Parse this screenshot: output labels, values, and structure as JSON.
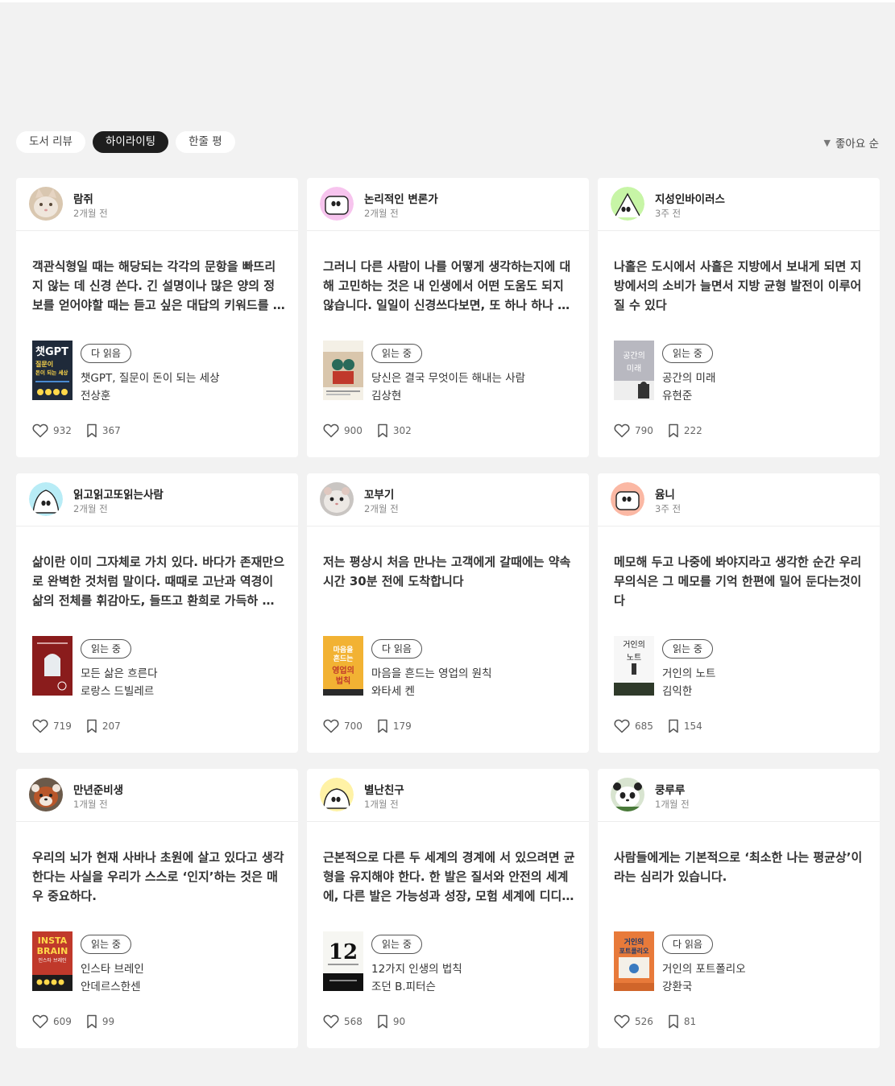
{
  "tabs": [
    {
      "label": "도서 리뷰",
      "active": false
    },
    {
      "label": "하이라이팅",
      "active": true
    },
    {
      "label": "한줄 평",
      "active": false
    }
  ],
  "sort": {
    "label": "좋아요 순",
    "icon": "caret-down-icon"
  },
  "cards": [
    {
      "user": "람쥐",
      "time": "2개월 전",
      "avatar": "cat-photo",
      "quote": "객관식형일 때는 해당되는 각각의 문항을 빠뜨리지 않는 데 신경 쓴다. 긴 설명이나 많은 양의 정보를 얻어야할 때는 듣고 싶은 대답의 키워드를 넣어서 질문한다.",
      "status": "다 읽음",
      "book_title": "챗GPT, 질문이 돈이 되는 세상",
      "book_author": "전상훈",
      "cover_text": [
        "챗GPT",
        "질문이",
        "돈이 되는 세상"
      ],
      "likes": "932",
      "bookmarks": "367"
    },
    {
      "user": "논리적인 변론가",
      "time": "2개월 전",
      "avatar": "pink-face",
      "quote": "그러니 다른 사람이 나를 어떻게 생각하는지에 대해 고민하는 것은 내 인생에서 어떤 도움도 되지 않습니다. 일일이 신경쓰다보면, 또 하나 하나 신경쓰다 보면",
      "status": "읽는 중",
      "book_title": "당신은 결국 무엇이든 해내는 사람",
      "book_author": "김상현",
      "cover_text": [],
      "likes": "900",
      "bookmarks": "302"
    },
    {
      "user": "지성인바이러스",
      "time": "3주 전",
      "avatar": "green-face",
      "quote": "나홀은 도시에서 사흘은 지방에서 보내게 되면 지방에서의 소비가 늘면서 지방 균형 발전이 이루어질 수 있다",
      "status": "읽는 중",
      "book_title": "공간의 미래",
      "book_author": "유현준",
      "cover_text": [
        "공간의",
        "미래"
      ],
      "likes": "790",
      "bookmarks": "222"
    },
    {
      "user": "읽고읽고또읽는사람",
      "time": "2개월 전",
      "avatar": "blue-face",
      "quote": "삶이란 이미 그자체로 가치 있다. 바다가 존재만으로 완벽한 것처럼 말이다. 때때로 고난과 역경이 삶의 전체를 휘감아도, 들뜨고 환희로 가득하 순간이 와도",
      "status": "읽는 중",
      "book_title": "모든 삶은 흐른다",
      "book_author": "로랑스 드빌레르",
      "cover_text": [],
      "likes": "719",
      "bookmarks": "207"
    },
    {
      "user": "꼬부기",
      "time": "2개월 전",
      "avatar": "hamster-photo",
      "quote": "저는 평상시 처음 만나는 고객에게 갈때에는  약속 시간 30분 전에 도착합니다",
      "status": "다 읽음",
      "book_title": "마음을 흔드는 영업의 원칙",
      "book_author": "와타세 켄",
      "cover_text": [
        "마음을",
        "흔드는",
        "영업의",
        "법칙"
      ],
      "likes": "700",
      "bookmarks": "179"
    },
    {
      "user": "윰니",
      "time": "3주 전",
      "avatar": "salmon-face",
      "quote": "메모해 두고 나중에 봐야지라고 생각한 순간 우리 무의식은 그 메모를 기억 한편에 밀어 둔다는것이다",
      "status": "읽는 중",
      "book_title": "거인의 노트",
      "book_author": "김익한",
      "cover_text": [
        "거인의",
        "노트"
      ],
      "likes": "685",
      "bookmarks": "154"
    },
    {
      "user": "만년준비생",
      "time": "1개월 전",
      "avatar": "redpanda-photo",
      "quote": "우리의 뇌가 현재 사바나 초원에 살고 있다고 생각한다는 사실을 우리가 스스로 ‘인지’하는 것은 매우 중요하다.",
      "status": "읽는 중",
      "book_title": "인스타 브레인",
      "book_author": "안데르스한센",
      "cover_text": [
        "INSTA",
        "BRAIN",
        "인스타 브레인"
      ],
      "likes": "609",
      "bookmarks": "99"
    },
    {
      "user": "별난친구",
      "time": "1개월 전",
      "avatar": "yellow-face",
      "quote": "근본적으로 다른 두 세계의 경계에 서 있으려면 균형을 유지해야 한다. 한 발은 질서와 안전의 세계에, 다른 발은 가능성과 성장, 모험 세계에 디디고 있어야 한다.",
      "status": "읽는 중",
      "book_title": "12가지 인생의 법칙",
      "book_author": "조던 B.피터슨",
      "cover_text": [
        "12"
      ],
      "likes": "568",
      "bookmarks": "90"
    },
    {
      "user": "쿵루루",
      "time": "1개월 전",
      "avatar": "panda-photo",
      "quote": "사람들에게는 기본적으로 ‘최소한 나는 평균상’이라는 심리가 있습니다.",
      "status": "다 읽음",
      "book_title": "거인의 포트폴리오",
      "book_author": "강환국",
      "cover_text": [
        "거인의",
        "포트폴리오"
      ],
      "likes": "526",
      "bookmarks": "81"
    }
  ]
}
